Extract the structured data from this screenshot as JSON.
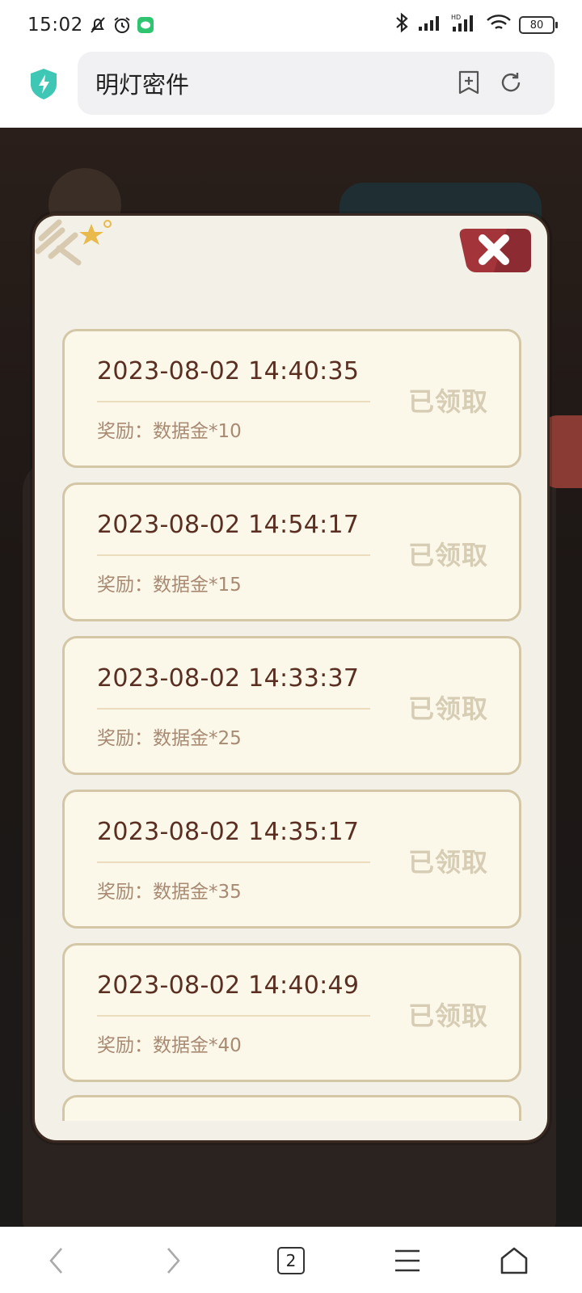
{
  "status_bar": {
    "time": "15:02",
    "battery": "80",
    "icons": [
      "mute-bell-icon",
      "alarm-icon",
      "chat-app-icon",
      "bluetooth-icon",
      "signal-icon",
      "hd-signal-icon",
      "wifi-icon",
      "battery-icon"
    ]
  },
  "browser": {
    "page_title": "明灯密件",
    "tab_count": "2"
  },
  "modal": {
    "records": [
      {
        "time": "2023-08-02  14:40:35",
        "reward": "奖励：数据金*10",
        "status": "已领取"
      },
      {
        "time": "2023-08-02  14:54:17",
        "reward": "奖励：数据金*15",
        "status": "已领取"
      },
      {
        "time": "2023-08-02  14:33:37",
        "reward": "奖励：数据金*25",
        "status": "已领取"
      },
      {
        "time": "2023-08-02  14:35:17",
        "reward": "奖励：数据金*35",
        "status": "已领取"
      },
      {
        "time": "2023-08-02  14:40:49",
        "reward": "奖励：数据金*40",
        "status": "已领取"
      }
    ]
  },
  "colors": {
    "card_bg": "#fbf8ea",
    "card_border": "#d3c7a7",
    "time_text": "#5a2f22",
    "reward_text": "#a88a73",
    "status_text": "#d7cdb4",
    "close_red": "#a3343a"
  }
}
